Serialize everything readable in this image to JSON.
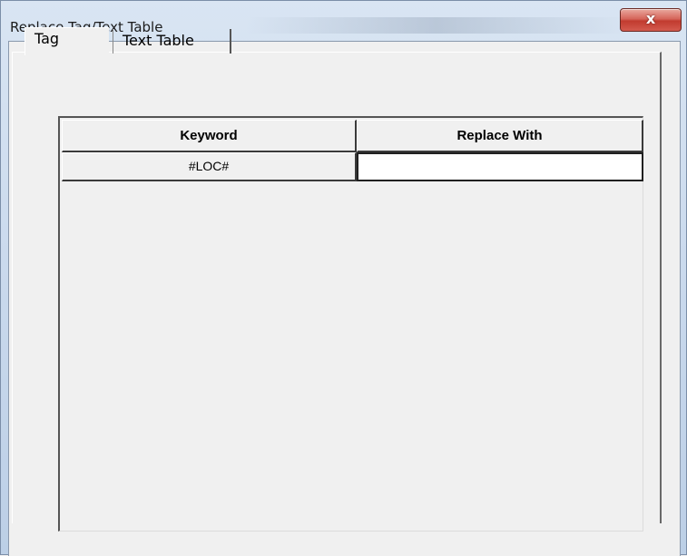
{
  "window": {
    "title": "Replace Tag/Text Table",
    "close_glyph": "x"
  },
  "tabs": [
    {
      "label": "Tag",
      "active": true
    },
    {
      "label": "Text Table",
      "active": false
    }
  ],
  "grid": {
    "columns": [
      "Keyword",
      "Replace With"
    ],
    "rows": [
      {
        "keyword": "#LOC#",
        "replace_with": ""
      }
    ]
  }
}
